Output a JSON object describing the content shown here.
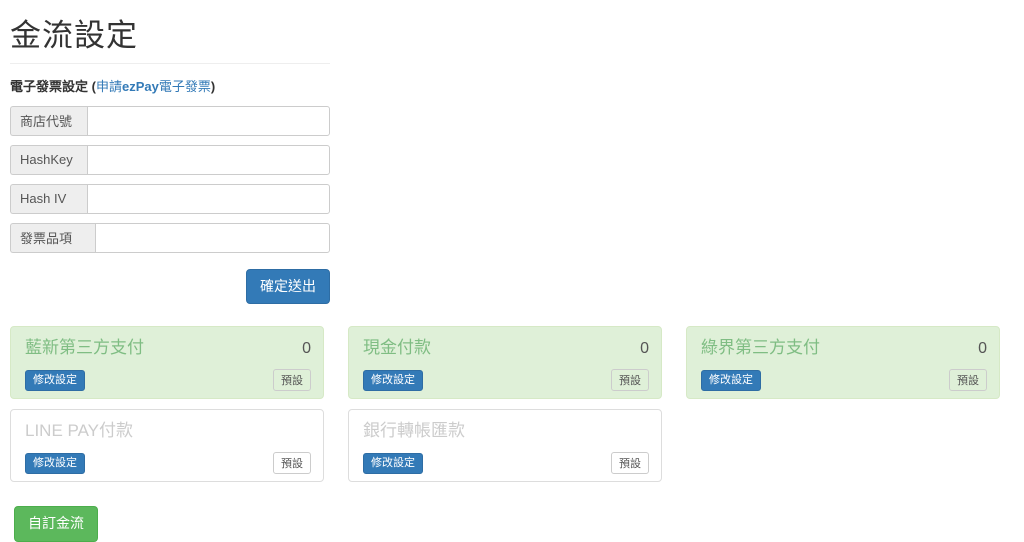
{
  "page": {
    "title": "金流設定"
  },
  "invoice_section": {
    "label_prefix": "電子發票設定 (",
    "link_pre": "申請",
    "link_brand": "ezPay",
    "link_post": "電子發票",
    "label_suffix": ")",
    "fields": [
      {
        "label": "商店代號",
        "value": "",
        "placeholder": ""
      },
      {
        "label": "HashKey",
        "value": "",
        "placeholder": ""
      },
      {
        "label": "Hash IV",
        "value": "",
        "placeholder": ""
      },
      {
        "label": "發票品項",
        "value": "",
        "placeholder": ""
      }
    ],
    "submit_label": "確定送出"
  },
  "payment_cards": [
    {
      "title": "藍新第三方支付",
      "count": "0",
      "edit_label": "修改設定",
      "default_label": "預設",
      "state": "active"
    },
    {
      "title": "現金付款",
      "count": "0",
      "edit_label": "修改設定",
      "default_label": "預設",
      "state": "active"
    },
    {
      "title": "綠界第三方支付",
      "count": "0",
      "edit_label": "修改設定",
      "default_label": "預設",
      "state": "active"
    },
    {
      "title": "LINE PAY付款",
      "count": "",
      "edit_label": "修改設定",
      "default_label": "預設",
      "state": "inactive"
    },
    {
      "title": "銀行轉帳匯款",
      "count": "",
      "edit_label": "修改設定",
      "default_label": "預設",
      "state": "inactive"
    }
  ],
  "bottom": {
    "custom_payment_label": "自訂金流"
  },
  "colors": {
    "primary": "#337ab7",
    "success": "#5cb85c",
    "card_active_bg": "#dff0d8",
    "card_active_border": "#d6e9c6",
    "card_inactive_border": "#dddddd",
    "link": "#337ab7"
  }
}
